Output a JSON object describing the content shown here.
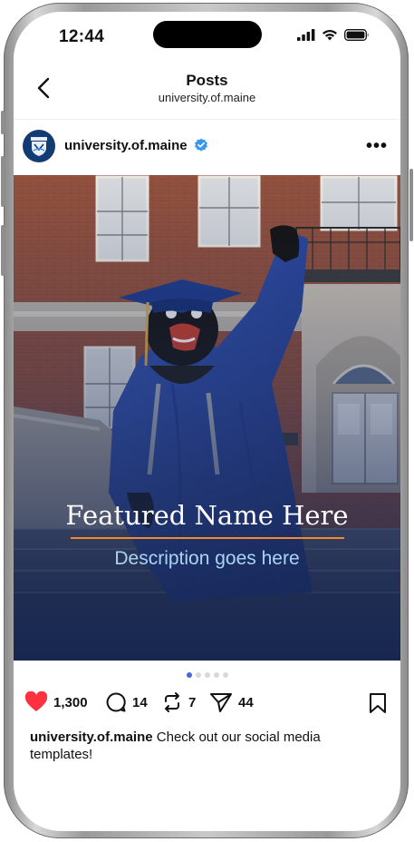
{
  "status_bar": {
    "time": "12:44",
    "icons": [
      "signal-icon",
      "wifi-icon",
      "battery-icon"
    ]
  },
  "nav": {
    "back_icon": "chevron-left-icon",
    "title": "Posts",
    "subtitle": "university.of.maine"
  },
  "post": {
    "username": "university.of.maine",
    "verified_icon": "verified-badge-icon",
    "more_icon": "more-dots-icon",
    "image": {
      "featured_name": "Featured Name Here",
      "description": "Description goes here"
    },
    "carousel": {
      "total": 5,
      "active_index": 0
    },
    "actions": {
      "likes": "1,300",
      "comments": "14",
      "reposts": "7",
      "shares": "44"
    },
    "caption": {
      "username": "university.of.maine",
      "text": "Check out our social media templates!"
    }
  },
  "colors": {
    "accent_blue": "#4a63d8",
    "heart_red": "#ff3040",
    "verified_blue": "#3897f0",
    "title_rule": "#f48a2a",
    "description_text": "#a9d4f2",
    "brand_navy": "#123a73"
  }
}
